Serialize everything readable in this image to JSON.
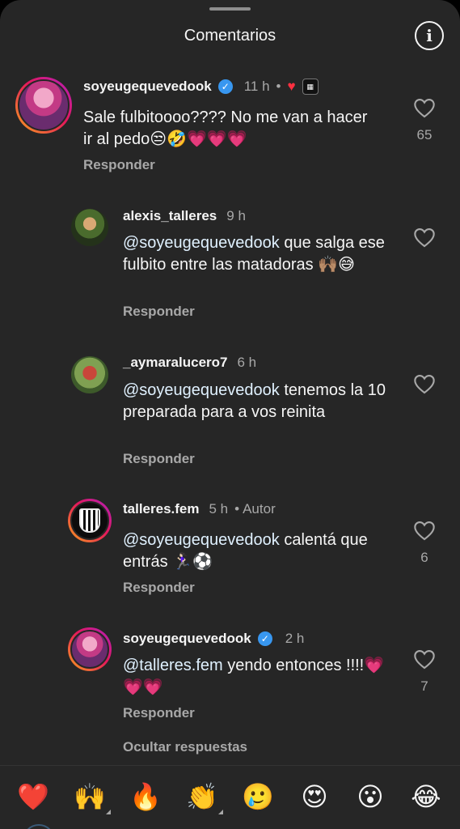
{
  "header": {
    "title": "Comentarios",
    "info_icon": "info-icon"
  },
  "comments": [
    {
      "username": "soyeugequevedook",
      "verified": true,
      "time": "11 h",
      "text": "Sale fulbitoooo???? No me van a hacer ir al pedo😒🤣💗💗💗",
      "reply_label": "Responder",
      "likes": "65"
    },
    {
      "username": "alexis_talleres",
      "verified": false,
      "time": "9 h",
      "mention": "@soyeugequevedook",
      "text": " que salga ese fulbito entre las matadoras 🙌🏽😅",
      "reply_label": "Responder",
      "likes": ""
    },
    {
      "username": "_aymaralucero7",
      "verified": false,
      "time": "6 h",
      "mention": "@soyeugequevedook",
      "text": " tenemos la 10 preparada para a vos reinita",
      "reply_label": "Responder",
      "likes": ""
    },
    {
      "username": "talleres.fem",
      "verified": false,
      "time": "5 h",
      "author_tag": "Autor",
      "mention": "@soyeugequevedook",
      "text": " calentá que entrás 🏃🏻‍♀️⚽",
      "reply_label": "Responder",
      "likes": "6"
    },
    {
      "username": "soyeugequevedook",
      "verified": true,
      "time": "2 h",
      "mention": "@talleres.fem",
      "text": " yendo entonces !!!!💗💗💗",
      "reply_label": "Responder",
      "likes": "7"
    }
  ],
  "hide_replies": "Ocultar respuestas",
  "reaction_emojis": [
    "❤️",
    "🙌",
    "🔥",
    "👏",
    "🥲",
    "😍",
    "😮",
    "😂"
  ],
  "colors": {
    "background": "#262626",
    "text": "#f5f5f5",
    "muted": "#a8a8a8",
    "verified": "#3897f0"
  }
}
